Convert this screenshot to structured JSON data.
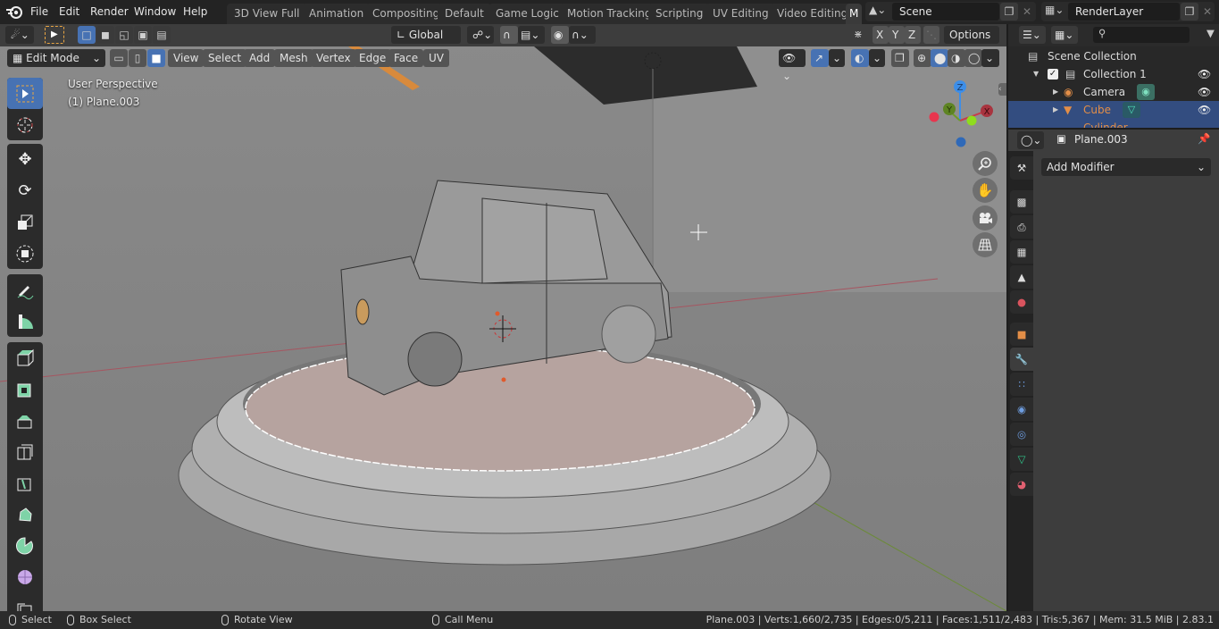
{
  "topbar": {
    "menus": [
      "File",
      "Edit",
      "Render",
      "Window",
      "Help"
    ],
    "workspace_tabs": [
      "3D View Full",
      "Animation",
      "Compositing",
      "Default",
      "Game Logic",
      "Motion Tracking",
      "Scripting",
      "UV Editing",
      "Video Editing",
      "M"
    ],
    "scene": "Scene",
    "view_layer": "RenderLayer"
  },
  "tool_header": {
    "orientation": "Global",
    "options_label": "Options",
    "axis_x": "X",
    "axis_y": "Y",
    "axis_z": "Z"
  },
  "viewport_header": {
    "mode": "Edit Mode",
    "menus": [
      "View",
      "Select",
      "Add",
      "Mesh",
      "Vertex",
      "Edge",
      "Face",
      "UV"
    ],
    "select_mode_active": "face"
  },
  "viewport": {
    "view_name": "User Perspective",
    "object_label": "(1) Plane.003",
    "gizmo": {
      "x": "X",
      "y": "Y",
      "z": "Z"
    },
    "colors": {
      "x": "#c83c4c",
      "y": "#6e9a28",
      "z": "#3d8ee8",
      "select": "#4772b3",
      "active_object": "#e38e47"
    }
  },
  "toolbar_tools": [
    "select-box",
    "cursor",
    "move",
    "rotate",
    "scale",
    "transform",
    "annotate",
    "measure",
    "extrude-region",
    "inset-faces",
    "bevel",
    "loop-cut",
    "knife",
    "poly-build",
    "spin",
    "smooth",
    "shrink-fatten"
  ],
  "outliner": {
    "root": "Scene Collection",
    "items": [
      {
        "name": "Collection 1",
        "type": "collection",
        "visible": true,
        "checked": true
      },
      {
        "name": "Camera",
        "type": "camera",
        "visible": true
      },
      {
        "name": "Cube",
        "type": "mesh",
        "visible": true,
        "selected": true
      },
      {
        "name": "Cylinder",
        "type": "mesh",
        "visible": true
      }
    ]
  },
  "properties": {
    "object_name": "Plane.003",
    "add_modifier_label": "Add Modifier",
    "tabs": [
      "tool",
      "render",
      "output",
      "view-layer",
      "scene",
      "world",
      "object",
      "modifiers",
      "particles",
      "physics",
      "constraints",
      "data",
      "material"
    ],
    "active_tab": "modifiers"
  },
  "statusbar": {
    "select": "Select",
    "box_select": "Box Select",
    "rotate_view": "Rotate View",
    "call_menu": "Call Menu",
    "stats": "Plane.003 | Verts:1,660/2,735 | Edges:0/5,211 | Faces:1,511/2,483 | Tris:5,367 | Mem: 31.5 MiB | 2.83.1"
  }
}
